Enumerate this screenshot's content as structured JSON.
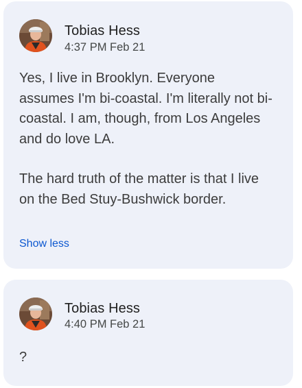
{
  "messages": [
    {
      "author": "Tobias Hess",
      "timestamp": "4:37 PM Feb 21",
      "paragraphs": [
        "Yes, I live in Brooklyn. Everyone assumes I'm bi-coastal. I'm literally not bi-coastal. I am, though, from Los Angeles and do love LA.",
        "The hard truth of the matter is that I live on the Bed Stuy-Bushwick border."
      ],
      "toggle_label": "Show less"
    },
    {
      "author": "Tobias Hess",
      "timestamp": "4:40 PM Feb 21",
      "paragraphs": [
        "?"
      ]
    }
  ]
}
